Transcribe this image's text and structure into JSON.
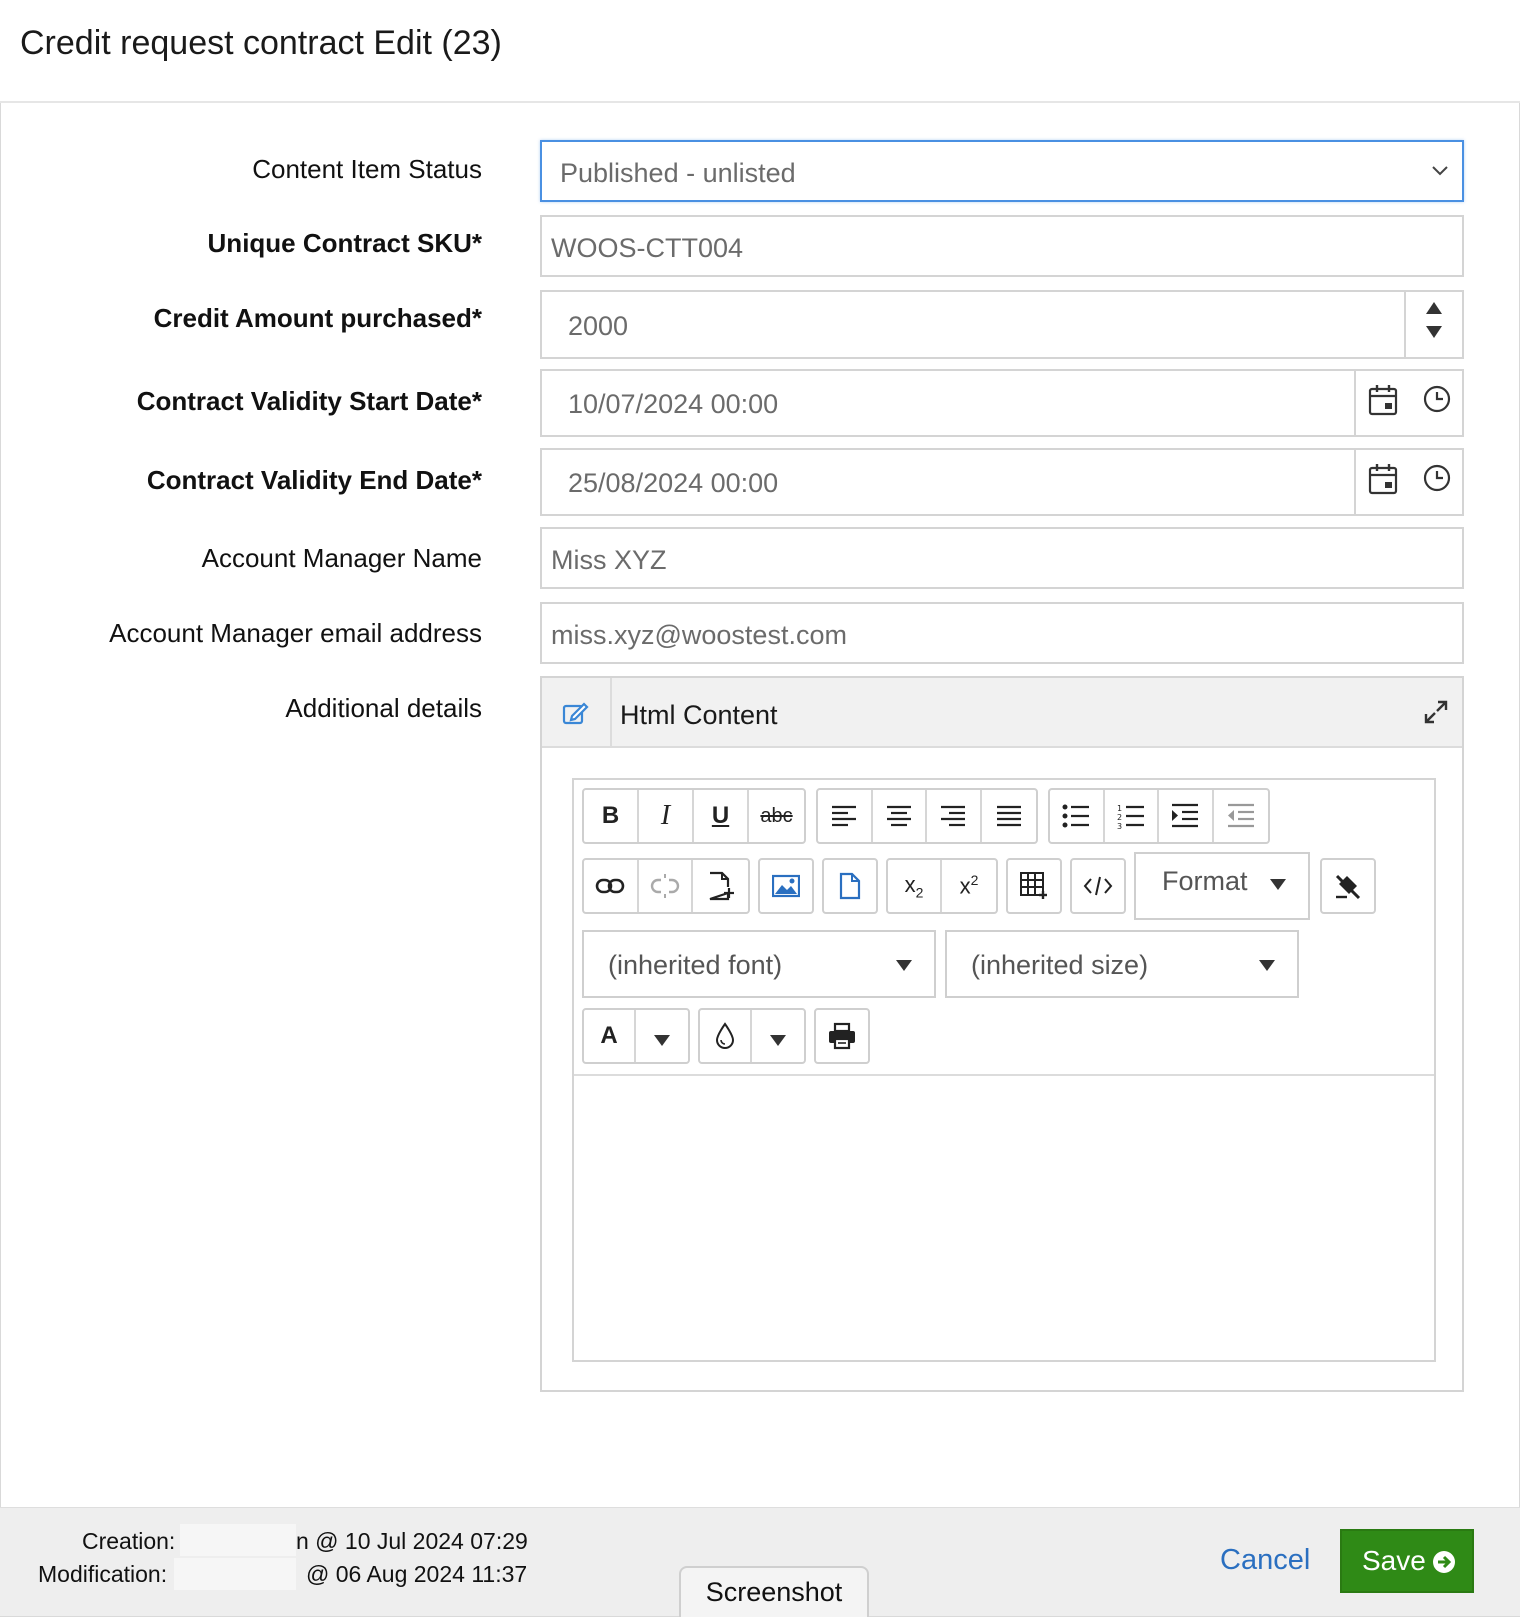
{
  "window": {
    "title": "Credit request contract Edit (23)"
  },
  "form": {
    "status": {
      "label": "Content Item Status",
      "value": "Published - unlisted"
    },
    "sku": {
      "label": "Unique Contract SKU*",
      "value": "WOOS-CTT004"
    },
    "credit": {
      "label": "Credit Amount purchased*",
      "value": "2000"
    },
    "start_date": {
      "label": "Contract Validity Start Date*",
      "value": "10/07/2024 00:00"
    },
    "end_date": {
      "label": "Contract Validity End Date*",
      "value": "25/08/2024 00:00"
    },
    "manager_name": {
      "label": "Account Manager Name",
      "value": "Miss XYZ"
    },
    "manager_email": {
      "label": "Account Manager email address",
      "value": "miss.xyz@woostest.com"
    },
    "details": {
      "label": "Additional details"
    }
  },
  "editor": {
    "header_title": "Html Content",
    "bold": "B",
    "italic": "I",
    "underline": "U",
    "strike": "abc",
    "format_label": "Format",
    "font_placeholder": "(inherited font)",
    "size_placeholder": "(inherited size)",
    "text_color_letter": "A",
    "sub_base": "x",
    "sub_digit": "2",
    "sup_base": "x",
    "sup_digit": "2"
  },
  "footer": {
    "creation_label": "Creation:",
    "creation_value": "n @ 10 Jul 2024 07:29",
    "modification_label": "Modification:",
    "modification_value": "@ 06 Aug 2024 11:37",
    "cancel_label": "Cancel",
    "save_label": "Save",
    "screenshot_tab": "Screenshot"
  },
  "colors": {
    "accent_blue": "#2a6fc0",
    "save_green": "#2f8a16",
    "focus_blue": "#4a90e2"
  },
  "icons": [
    "chevron-down-icon",
    "spinner-up-icon",
    "spinner-down-icon",
    "calendar-icon",
    "clock-icon",
    "edit-icon",
    "expand-icon",
    "link-icon",
    "unlink-icon",
    "new-page-icon",
    "image-icon",
    "file-icon",
    "subscript-icon",
    "superscript-icon",
    "table-icon",
    "source-code-icon",
    "remove-format-icon",
    "drop-icon",
    "print-icon",
    "arrow-circle-right-icon"
  ]
}
